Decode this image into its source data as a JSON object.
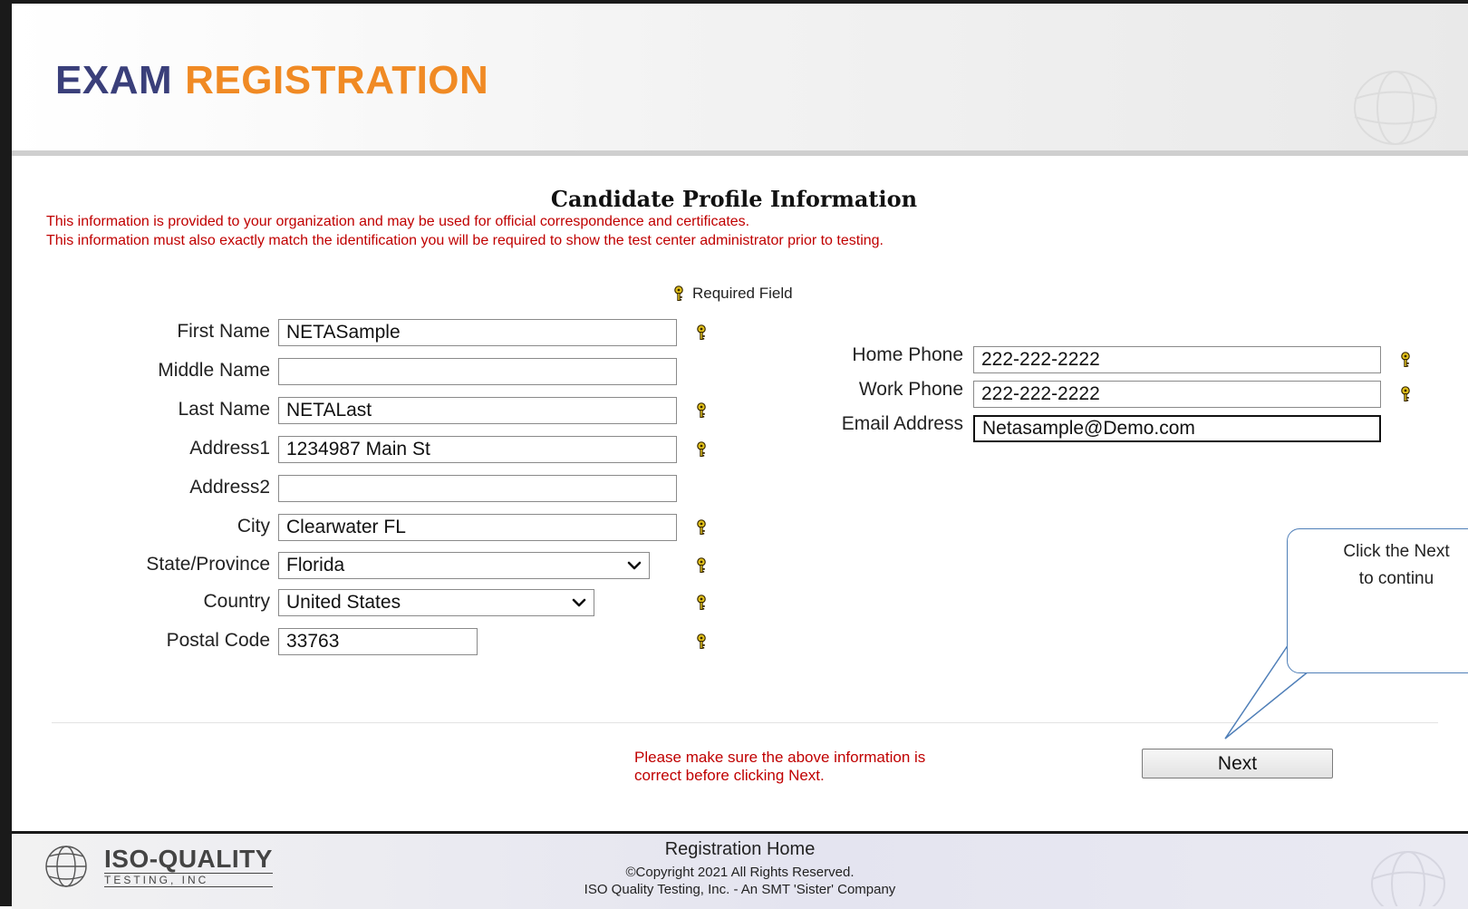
{
  "header": {
    "title_part1": "EXAM",
    "title_part2": "REGISTRATION"
  },
  "section_title": "Candidate Profile Information",
  "notice": {
    "line1": "This information is provided to your organization and may be used for official correspondence and certificates.",
    "line2": "This information must also exactly match the identification you will be required to show the test center administrator prior to testing."
  },
  "required_legend": "Required Field",
  "form": {
    "first_name": {
      "label": "First Name",
      "value": "NETASample"
    },
    "middle_name": {
      "label": "Middle Name",
      "value": ""
    },
    "last_name": {
      "label": "Last Name",
      "value": "NETALast"
    },
    "address1": {
      "label": "Address1",
      "value": "1234987 Main St"
    },
    "address2": {
      "label": "Address2",
      "value": ""
    },
    "city": {
      "label": "City",
      "value": "Clearwater FL"
    },
    "state": {
      "label": "State/Province",
      "value": "Florida"
    },
    "country": {
      "label": "Country",
      "value": "United States"
    },
    "postal_code": {
      "label": "Postal Code",
      "value": "33763"
    },
    "home_phone": {
      "label": "Home Phone",
      "value": "222-222-2222"
    },
    "work_phone": {
      "label": "Work Phone",
      "value": "222-222-2222"
    },
    "email": {
      "label": "Email Address",
      "value": "Netasample@Demo.com"
    }
  },
  "confirm_text": "Please make sure the above information is correct before clicking Next.",
  "next_label": "Next",
  "callout": {
    "line1": "Click the Next",
    "line2": "to continu"
  },
  "footer": {
    "registration_home": "Registration Home",
    "copyright": "©Copyright 2021 All Rights Reserved.",
    "company": "ISO Quality Testing, Inc. - An SMT 'Sister' Company",
    "logo_main": "ISO-QUALITY",
    "logo_sub": "TESTING, INC"
  },
  "colors": {
    "title_blue": "#3a3f7a",
    "title_orange": "#f08a24",
    "notice_red": "#c00000",
    "key_yellow": "#e3c21a"
  },
  "icons": {
    "required": "key-icon",
    "dropdown": "chevron-down-icon",
    "logo": "globe-icon"
  }
}
